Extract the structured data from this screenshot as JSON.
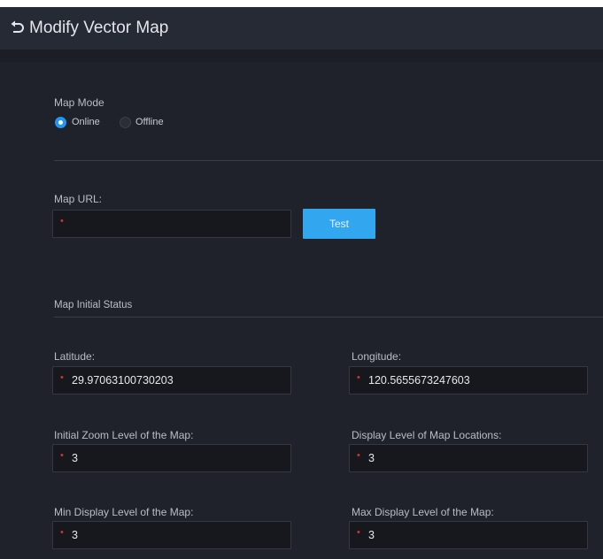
{
  "header": {
    "title": "Modify Vector Map",
    "back_icon": "back-arrow-icon"
  },
  "map_mode": {
    "label": "Map Mode",
    "options": [
      {
        "label": "Online",
        "checked": true
      },
      {
        "label": "Offline",
        "checked": false
      }
    ]
  },
  "map_url": {
    "label": "Map URL:",
    "value": "",
    "test_label": "Test"
  },
  "initial_status": {
    "heading": "Map Initial Status",
    "latitude": {
      "label": "Latitude:",
      "value": "29.97063100730203"
    },
    "longitude": {
      "label": "Longitude:",
      "value": "120.5655673247603"
    },
    "initial_zoom": {
      "label": "Initial Zoom Level of the Map:",
      "value": "3"
    },
    "display_level": {
      "label": "Display Level of Map Locations:",
      "value": "3"
    },
    "min_level": {
      "label": "Min Display Level of the Map:",
      "value": "3"
    },
    "max_level": {
      "label": "Max Display Level of the Map:",
      "value": "3"
    }
  },
  "colors": {
    "accent": "#33a6f0",
    "background": "#1f222b",
    "required": "#d0342c"
  }
}
